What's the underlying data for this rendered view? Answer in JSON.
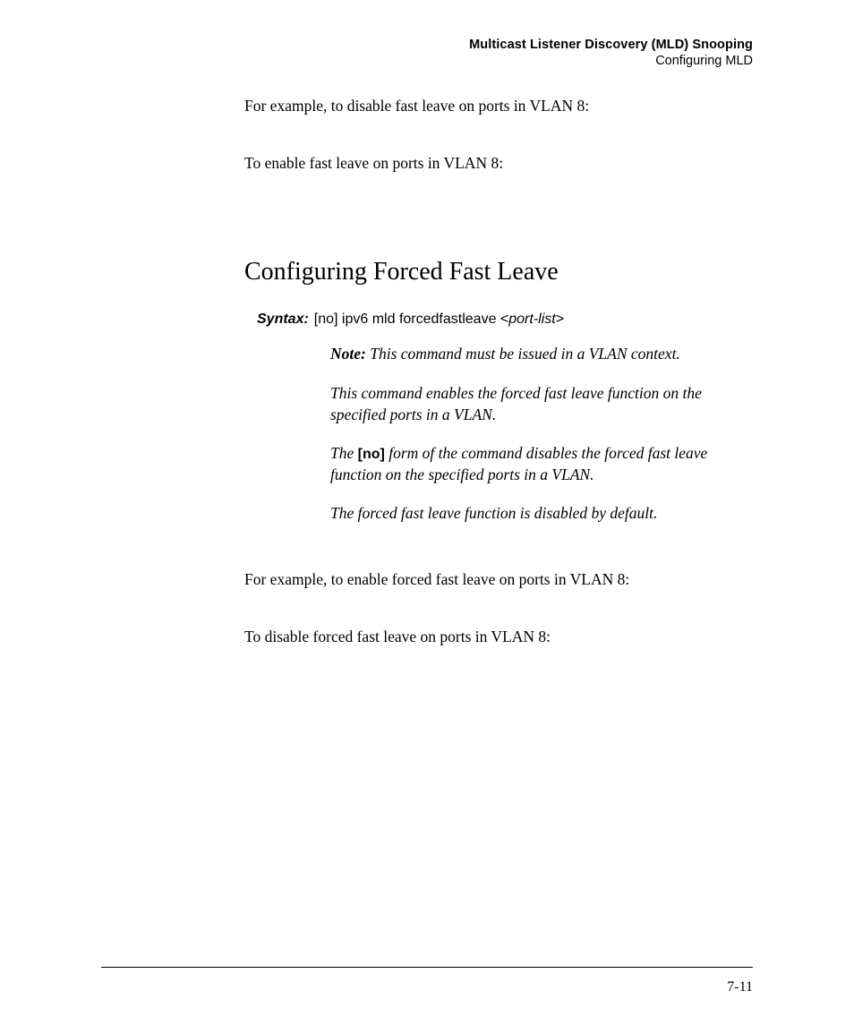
{
  "header": {
    "title": "Multicast Listener Discovery (MLD) Snooping",
    "subtitle": "Configuring MLD"
  },
  "body": {
    "p1": "For example, to disable fast leave on ports in VLAN 8:",
    "p2": "To enable fast leave on ports in VLAN 8:",
    "h2": "Configuring Forced Fast Leave",
    "syntax_label": "Syntax:",
    "syntax_cmd_prefix": "[no] ipv6 mld forcedfastleave ",
    "syntax_cmd_lt": "<",
    "syntax_cmd_arg": "port-list",
    "syntax_cmd_gt": ">",
    "note_label": "Note:",
    "note_text": " This command must be issued in a VLAN context.",
    "desc1": "This command enables the forced fast leave function on the specified ports in a VLAN.",
    "desc2a": "The ",
    "desc2_no": "[no]",
    "desc2b": " form of the command disables the forced fast leave function on the specified ports in a VLAN.",
    "desc3": "The forced fast leave function is disabled by default.",
    "p3": "For example, to enable forced fast leave on ports in VLAN 8:",
    "p4": "To disable forced fast leave on ports in VLAN 8:"
  },
  "footer": {
    "page_num": "7-11"
  }
}
